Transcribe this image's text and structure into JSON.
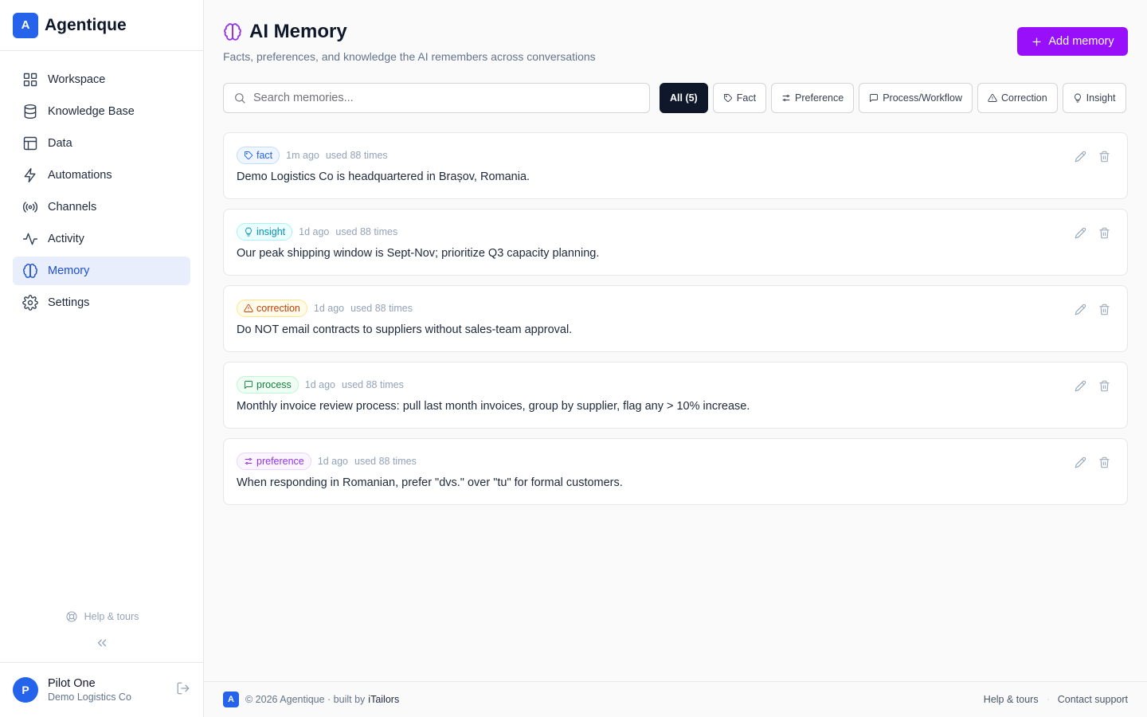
{
  "brand": {
    "logo_letter": "A",
    "name": "Agentique"
  },
  "nav": [
    {
      "label": "Workspace",
      "icon": "grid-icon"
    },
    {
      "label": "Knowledge Base",
      "icon": "database-icon"
    },
    {
      "label": "Data",
      "icon": "table-icon"
    },
    {
      "label": "Automations",
      "icon": "lightning-icon"
    },
    {
      "label": "Channels",
      "icon": "broadcast-icon"
    },
    {
      "label": "Activity",
      "icon": "activity-icon"
    },
    {
      "label": "Memory",
      "icon": "brain-icon",
      "active": true
    },
    {
      "label": "Settings",
      "icon": "gear-icon"
    }
  ],
  "sidebar": {
    "help_label": "Help & tours"
  },
  "user": {
    "initial": "P",
    "name": "Pilot One",
    "org": "Demo Logistics Co"
  },
  "header": {
    "title": "AI Memory",
    "subtitle": "Facts, preferences, and knowledge the AI remembers across conversations",
    "add_label": "Add memory"
  },
  "search": {
    "placeholder": "Search memories...",
    "value": ""
  },
  "filters": [
    {
      "label": "All (5)",
      "icon": "",
      "active": true
    },
    {
      "label": "Fact",
      "icon": "tag-icon"
    },
    {
      "label": "Preference",
      "icon": "sliders-icon"
    },
    {
      "label": "Process/Workflow",
      "icon": "message-square-icon"
    },
    {
      "label": "Correction",
      "icon": "warning-triangle-icon"
    },
    {
      "label": "Insight",
      "icon": "lightbulb-icon"
    }
  ],
  "memories": [
    {
      "type": "fact",
      "icon": "tag-icon",
      "color": "#2563eb",
      "bg": "#eff6ff",
      "border": "#bfdbfe",
      "ago": "1m ago",
      "used": "used 88 times",
      "text": "Demo Logistics Co is headquartered in Brașov, Romania."
    },
    {
      "type": "insight",
      "icon": "lightbulb-icon",
      "color": "#0891b2",
      "bg": "#ecfeff",
      "border": "#a5f3fc",
      "ago": "1d ago",
      "used": "used 88 times",
      "text": "Our peak shipping window is Sept-Nov; prioritize Q3 capacity planning."
    },
    {
      "type": "correction",
      "icon": "warning-triangle-icon",
      "color": "#c2410c",
      "bg": "#fffbeb",
      "border": "#fde68a",
      "ago": "1d ago",
      "used": "used 88 times",
      "text": "Do NOT email contracts to suppliers without sales-team approval."
    },
    {
      "type": "process",
      "icon": "message-square-icon",
      "color": "#15803d",
      "bg": "#f0fdf4",
      "border": "#bbf7d0",
      "ago": "1d ago",
      "used": "used 88 times",
      "text": "Monthly invoice review process: pull last month invoices, group by supplier, flag any > 10% increase."
    },
    {
      "type": "preference",
      "icon": "sliders-icon",
      "color": "#9333ea",
      "bg": "#faf5ff",
      "border": "#e9d5ff",
      "ago": "1d ago",
      "used": "used 88 times",
      "text": "When responding in Romanian, prefer \"dvs.\" over \"tu\" for formal customers."
    }
  ],
  "footer": {
    "logo_letter": "A",
    "copyright": "© 2026 Agentique · built by",
    "builder": "iTailors",
    "help": "Help & tours",
    "separator": "·",
    "contact": "Contact support"
  },
  "colors": {
    "accent": "#9810fa",
    "brand": "#2563eb",
    "active_nav_bg": "#e8eefb"
  }
}
